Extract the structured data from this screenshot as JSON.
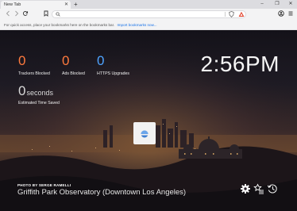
{
  "browser": {
    "tab_title": "New Tab",
    "new_tab_symbol": "+",
    "window_controls": [
      "–",
      "❐",
      "✕"
    ]
  },
  "bookmarks_bar": {
    "message": "For quick access, place your bookmarks here on the bookmarks bar.",
    "import_link": "Import bookmarks now..."
  },
  "urlbar": {
    "value": ""
  },
  "stats": {
    "trackers_blocked": {
      "value": "0",
      "label": "Trackers Blocked"
    },
    "ads_blocked": {
      "value": "0",
      "label": "Ads Blocked"
    },
    "https_upgrades": {
      "value": "0",
      "label": "HTTPS Upgrades"
    },
    "time_saved": {
      "value": "0",
      "unit": "seconds",
      "label": "Estimated Time Saved"
    }
  },
  "clock": "2:56PM",
  "photo": {
    "credit": "PHOTO BY SERGE RAMELLI",
    "location": "Griffith Park Observatory (Downtown Los Angeles)"
  },
  "colors": {
    "stat_orange": "#ff7a3d",
    "stat_blue": "#4ea3ff",
    "rewards_red": "#e2452f",
    "link_blue": "#1a73e8"
  }
}
